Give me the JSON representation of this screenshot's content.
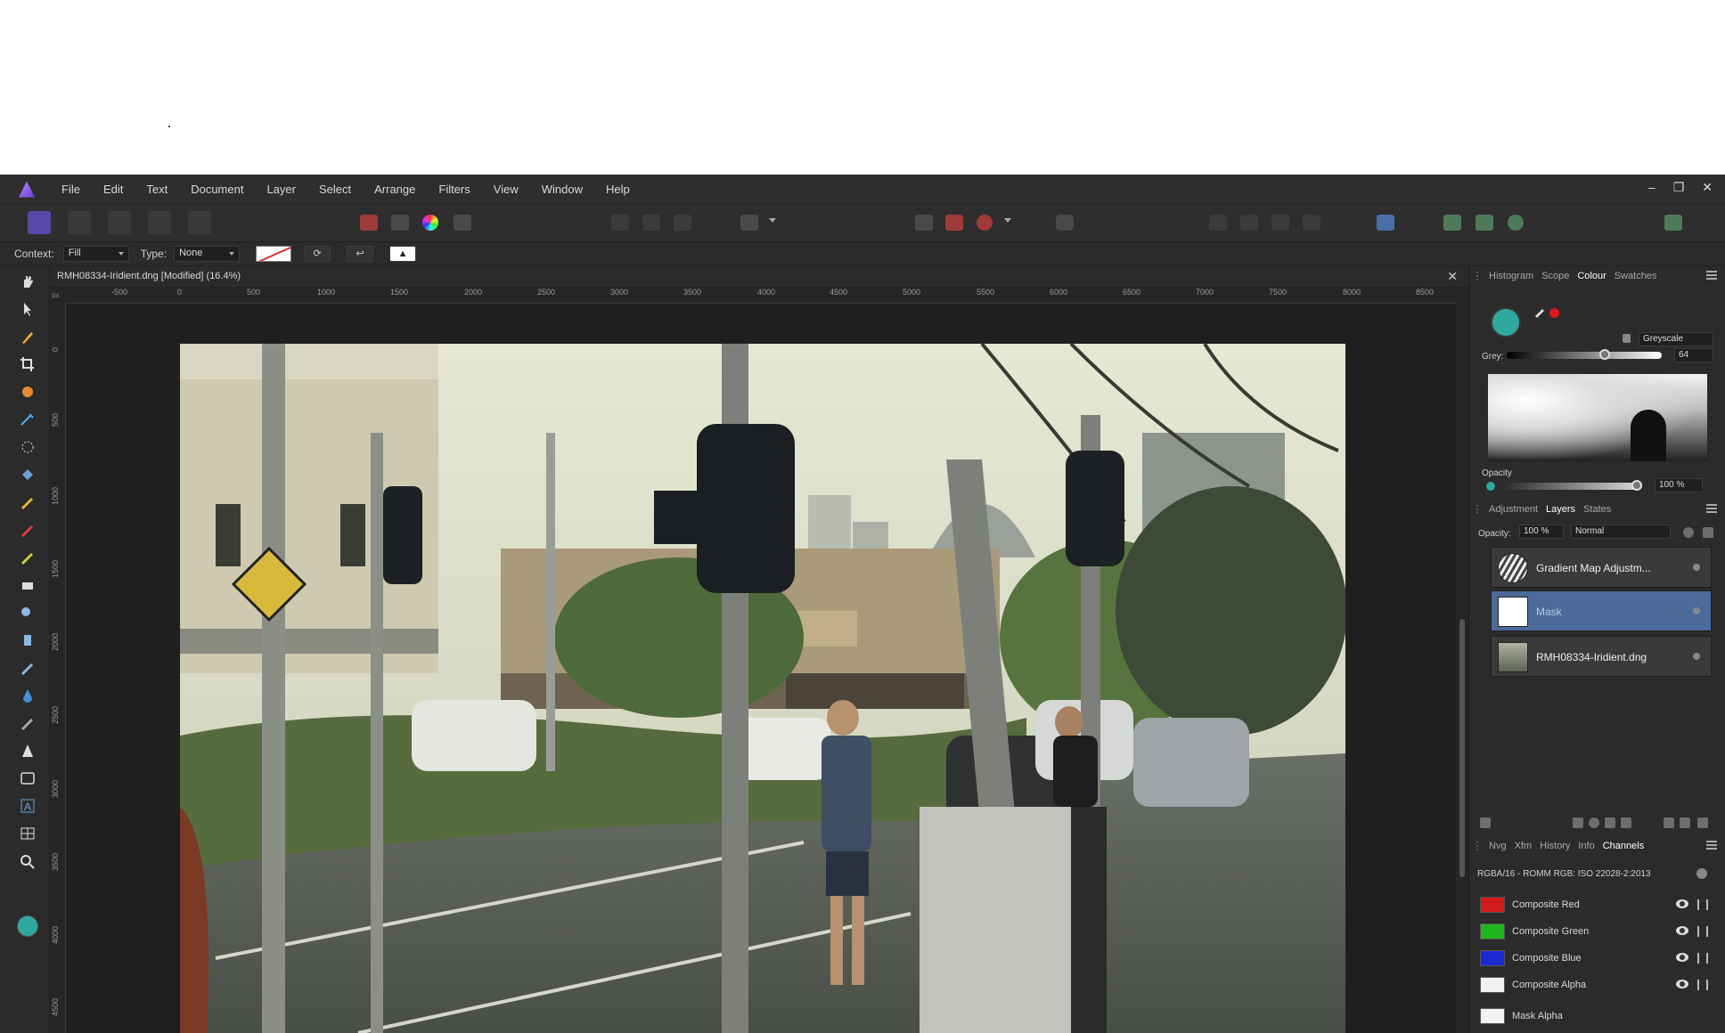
{
  "menubar": {
    "items": [
      "File",
      "Edit",
      "Text",
      "Document",
      "Layer",
      "Select",
      "Arrange",
      "Filters",
      "View",
      "Window",
      "Help"
    ],
    "window_controls": [
      "–",
      "❐",
      "✕"
    ]
  },
  "toolbar": {
    "personas": [
      "photo-persona-icon",
      "liquify-persona-icon",
      "develop-persona-icon",
      "tone-mapping-persona-icon",
      "export-persona-icon"
    ]
  },
  "context_bar": {
    "context_label": "Context:",
    "context_value": "Fill",
    "type_label": "Type:",
    "type_value": "None"
  },
  "document": {
    "tab_title": "RMH08334-Iridient.dng [Modified] (16.4%)",
    "close": "✕",
    "ruler_unit": "px",
    "ruler_top": [
      "-500",
      "0",
      "500",
      "1000",
      "1500",
      "2000",
      "2500",
      "3000",
      "3500",
      "4000",
      "4500",
      "5000",
      "5500",
      "6000",
      "6500",
      "7000",
      "7500",
      "8000",
      "8500"
    ],
    "ruler_left": [
      "0",
      "500",
      "1000",
      "1500",
      "2000",
      "2500",
      "3000",
      "3500",
      "4000",
      "4500"
    ],
    "photo_alt": "street-scene"
  },
  "colours": {
    "accent_teal": "#2fa8a0",
    "selected_layer": "#4c6a9a",
    "red_dot": "#e01818"
  },
  "panels": {
    "top_tabs": [
      "Histogram",
      "Scope",
      "Colour",
      "Swatches"
    ],
    "top_active": "Colour",
    "colour_mode": "Greyscale",
    "grey_label": "Grey:",
    "grey_value": "64",
    "grey_level": 0.64,
    "opacity_label": "Opacity",
    "opacity_value": "100 %",
    "mid_tabs": [
      "Adjustment",
      "Layers",
      "States"
    ],
    "mid_active": "Layers",
    "layers_opacity_label": "Opacity:",
    "layers_opacity_value": "100 %",
    "blend_mode": "Normal",
    "layers": [
      {
        "name": "Gradient Map Adjustm..."
      },
      {
        "name": "Mask"
      },
      {
        "name": "RMH08334-Iridient.dng"
      }
    ],
    "bottom_tabs": [
      "Nvg",
      "Xfm",
      "History",
      "Info",
      "Channels"
    ],
    "bottom_active": "Channels",
    "colour_space": "RGBA/16 - ROMM RGB: ISO 22028-2:2013",
    "channels": [
      {
        "name": "Composite Red",
        "colour": "#d21b1b"
      },
      {
        "name": "Composite Green",
        "colour": "#1fb51f"
      },
      {
        "name": "Composite Blue",
        "colour": "#1b2ad2"
      },
      {
        "name": "Composite Alpha",
        "colour": "#f2f2f2"
      },
      {
        "name": "Mask Alpha",
        "colour": "#f2f2f2"
      }
    ]
  }
}
